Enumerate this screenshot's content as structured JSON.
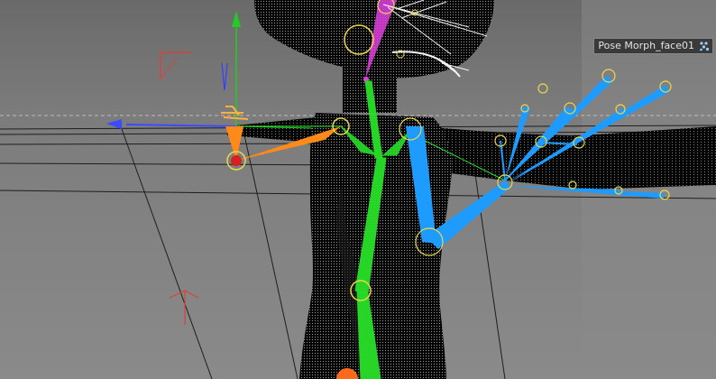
{
  "viewport": {
    "label": "Pose Morph_face01",
    "label_icon": "pose-morph-tag-icon",
    "background": "#7a7a7a",
    "colors": {
      "axis_x": "#3b4bff",
      "axis_y": "#22cc22",
      "bone_spine": "#28e028",
      "bone_right_arm": "#1e9bff",
      "bone_left_arm": "#ff8a1a",
      "head_bones": "#e040e0",
      "joint_circle": "#e8d84a",
      "mesh": "#050505",
      "grid": "#1e1e1e"
    }
  }
}
